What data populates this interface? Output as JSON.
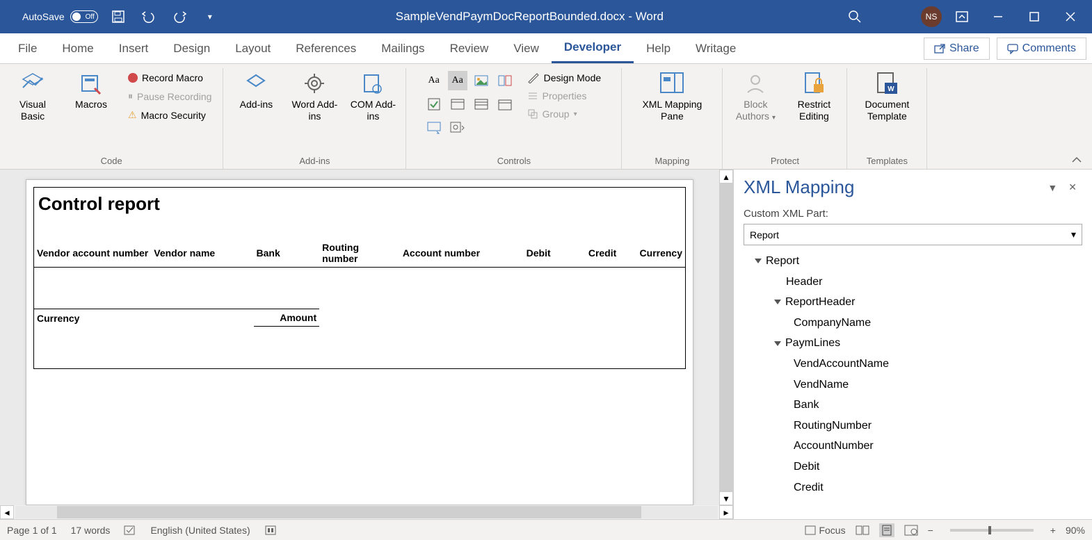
{
  "titlebar": {
    "autosave_label": "AutoSave",
    "autosave_state": "Off",
    "doc_title": "SampleVendPaymDocReportBounded.docx - Word",
    "user_initials": "NS"
  },
  "tabs": {
    "file": "File",
    "home": "Home",
    "insert": "Insert",
    "design": "Design",
    "layout": "Layout",
    "references": "References",
    "mailings": "Mailings",
    "review": "Review",
    "view": "View",
    "developer": "Developer",
    "help": "Help",
    "writage": "Writage",
    "share": "Share",
    "comments": "Comments"
  },
  "ribbon": {
    "code": {
      "visual_basic": "Visual Basic",
      "macros": "Macros",
      "record_macro": "Record Macro",
      "pause_recording": "Pause Recording",
      "macro_security": "Macro Security",
      "group": "Code"
    },
    "addins": {
      "addins": "Add-ins",
      "word_addins": "Word Add-ins",
      "com_addins": "COM Add-ins",
      "group": "Add-ins"
    },
    "controls": {
      "design_mode": "Design Mode",
      "properties": "Properties",
      "group_btn": "Group",
      "group": "Controls"
    },
    "mapping": {
      "xml_mapping": "XML Mapping Pane",
      "group": "Mapping"
    },
    "protect": {
      "block_authors": "Block Authors",
      "restrict": "Restrict Editing",
      "group": "Protect"
    },
    "templates": {
      "doc_template": "Document Template",
      "group": "Templates"
    }
  },
  "document": {
    "title": "Control report",
    "headers": {
      "vendor_account": "Vendor account number",
      "vendor_name": "Vendor name",
      "bank": "Bank",
      "routing": "Routing number",
      "account": "Account number",
      "debit": "Debit",
      "credit": "Credit",
      "currency": "Currency"
    },
    "sub": {
      "currency": "Currency",
      "amount": "Amount"
    }
  },
  "xml_pane": {
    "title": "XML Mapping",
    "sub": "Custom XML Part:",
    "select": "Report",
    "tree": {
      "report": "Report",
      "header": "Header",
      "report_header": "ReportHeader",
      "company_name": "CompanyName",
      "paym_lines": "PaymLines",
      "vend_account": "VendAccountName",
      "vend_name": "VendName",
      "bank": "Bank",
      "routing": "RoutingNumber",
      "account": "AccountNumber",
      "debit": "Debit",
      "credit": "Credit"
    }
  },
  "status": {
    "page": "Page 1 of 1",
    "words": "17 words",
    "lang": "English (United States)",
    "focus": "Focus",
    "zoom": "90%"
  }
}
